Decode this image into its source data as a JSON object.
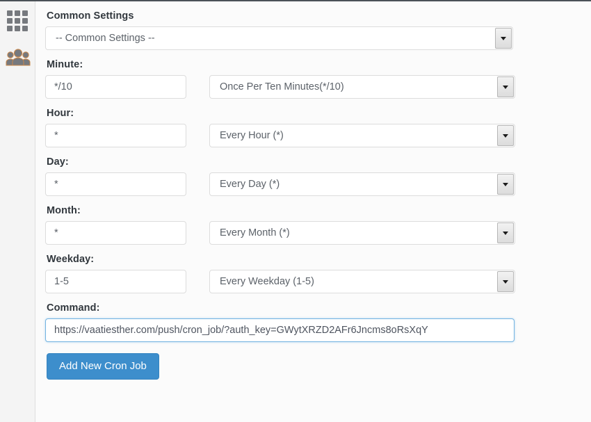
{
  "sidebar": {
    "items": [
      {
        "name": "grid-icon",
        "label": "Dashboard"
      },
      {
        "name": "users-icon",
        "label": "Users"
      }
    ]
  },
  "form": {
    "common_settings": {
      "label": "Common Settings",
      "selected": "-- Common Settings --"
    },
    "fields": [
      {
        "label": "Minute:",
        "value": "*/10",
        "preset": "Once Per Ten Minutes(*/10)"
      },
      {
        "label": "Hour:",
        "value": "*",
        "preset": "Every Hour (*)"
      },
      {
        "label": "Day:",
        "value": "*",
        "preset": "Every Day (*)"
      },
      {
        "label": "Month:",
        "value": "*",
        "preset": "Every Month (*)"
      },
      {
        "label": "Weekday:",
        "value": "1-5",
        "preset": "Every Weekday (1-5)"
      }
    ],
    "command": {
      "label": "Command:",
      "value": "https://vaatiesther.com/push/cron_job/?auth_key=GWytXRZD2AFr6Jncms8oRsXqY"
    },
    "submit_label": "Add New Cron Job"
  },
  "colors": {
    "accent": "#3d8ecc",
    "label_text": "#31373d",
    "input_text": "#5c6269",
    "sidebar_bg": "#f4f4f4",
    "page_bg": "#fbfbfb",
    "focus_border": "#73b3e0",
    "icon_gray": "#76797e"
  }
}
